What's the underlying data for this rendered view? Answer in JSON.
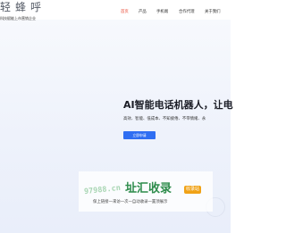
{
  "brand": {
    "name": "轻蜂呼",
    "tagline": "科技赋能上市营销企业"
  },
  "nav": {
    "items": [
      {
        "label": "首页",
        "active": true
      },
      {
        "label": "产品",
        "active": false
      },
      {
        "label": "手机端",
        "active": false
      },
      {
        "label": "合作代理",
        "active": false
      },
      {
        "label": "关于我们",
        "active": false
      }
    ]
  },
  "hero": {
    "headline": "AI智能电话机器人，让电",
    "tagline": "高效、智能、低成本、不知疲倦、不带情绪、永",
    "cta_label": "立即申请"
  },
  "watermark": {
    "digits": "97988.cn",
    "title": "址汇收录",
    "badge": "收录站",
    "subtitle": "保上链接一来访一次一自动收录一置顶展示"
  },
  "colors": {
    "nav_active": "#e8412c",
    "cta": "#2f6ef2",
    "watermark_green": "#2e8c4c",
    "badge": "#f0a216"
  }
}
